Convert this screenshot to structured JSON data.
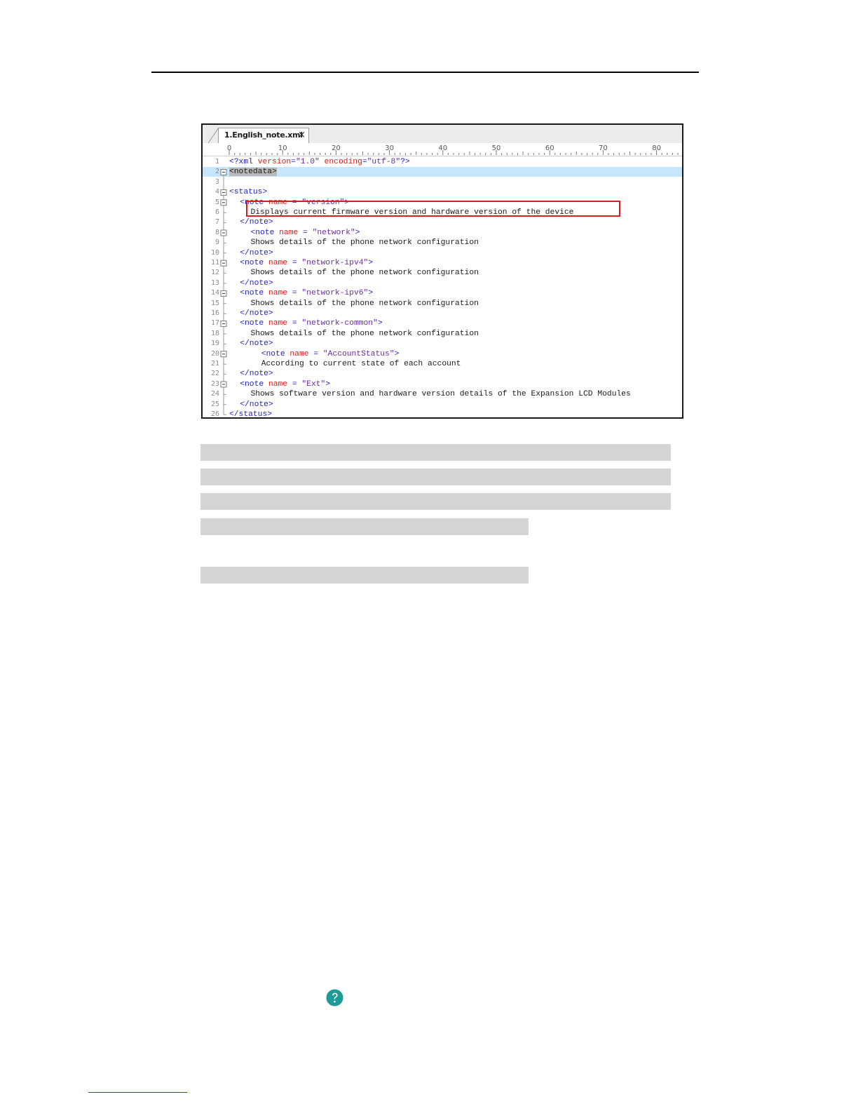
{
  "editor": {
    "tab_title": "1.English_note.xml",
    "tab_close": "×",
    "ruler_labels": [
      "0",
      "10",
      "20",
      "30",
      "40",
      "50",
      "60",
      "70",
      "80"
    ],
    "colors": {
      "tag": "#1f22c4",
      "attr": "#e01a1a",
      "value": "#6a2b9e",
      "current_line": "#c6e6fb",
      "highlight_box": "#d81e1e"
    },
    "lines": [
      {
        "n": "1",
        "indent": 0,
        "parts": [
          [
            "pi",
            "<?xml "
          ],
          [
            "attr",
            "version"
          ],
          [
            "pi",
            "="
          ],
          [
            "val",
            "\"1.0\""
          ],
          [
            "pi",
            " "
          ],
          [
            "attr",
            "encoding"
          ],
          [
            "pi",
            "="
          ],
          [
            "val",
            "\"utf-8\""
          ],
          [
            "pi",
            "?>"
          ]
        ]
      },
      {
        "n": "2",
        "indent": 0,
        "parts": [
          [
            "sel",
            "<notedata>"
          ]
        ]
      },
      {
        "n": "3",
        "indent": 0,
        "parts": []
      },
      {
        "n": "4",
        "indent": 0,
        "parts": [
          [
            "tag",
            "<status>"
          ]
        ]
      },
      {
        "n": "5",
        "indent": 2,
        "parts": [
          [
            "tag",
            "<note "
          ],
          [
            "attr",
            "name"
          ],
          [
            "tag",
            " = "
          ],
          [
            "val",
            "\"version\""
          ],
          [
            "tag",
            ">"
          ]
        ]
      },
      {
        "n": "6",
        "indent": 4,
        "parts": [
          [
            "txt",
            "Displays current firmware version and hardware version of the device"
          ]
        ]
      },
      {
        "n": "7",
        "indent": 2,
        "parts": [
          [
            "tag",
            "</note>"
          ]
        ]
      },
      {
        "n": "8",
        "indent": 4,
        "parts": [
          [
            "tag",
            "<note "
          ],
          [
            "attr",
            "name"
          ],
          [
            "tag",
            " = "
          ],
          [
            "val",
            "\"network\""
          ],
          [
            "tag",
            ">"
          ]
        ]
      },
      {
        "n": "9",
        "indent": 4,
        "parts": [
          [
            "txt",
            "Shows details of the phone network configuration"
          ]
        ]
      },
      {
        "n": "10",
        "indent": 2,
        "parts": [
          [
            "tag",
            "</note>"
          ]
        ]
      },
      {
        "n": "11",
        "indent": 2,
        "parts": [
          [
            "tag",
            "<note "
          ],
          [
            "attr",
            "name"
          ],
          [
            "tag",
            " = "
          ],
          [
            "val",
            "\"network-ipv4\""
          ],
          [
            "tag",
            ">"
          ]
        ]
      },
      {
        "n": "12",
        "indent": 4,
        "parts": [
          [
            "txt",
            "Shows details of the phone network configuration"
          ]
        ]
      },
      {
        "n": "13",
        "indent": 2,
        "parts": [
          [
            "tag",
            "</note>"
          ]
        ]
      },
      {
        "n": "14",
        "indent": 2,
        "parts": [
          [
            "tag",
            "<note "
          ],
          [
            "attr",
            "name"
          ],
          [
            "tag",
            " = "
          ],
          [
            "val",
            "\"network-ipv6\""
          ],
          [
            "tag",
            ">"
          ]
        ]
      },
      {
        "n": "15",
        "indent": 4,
        "parts": [
          [
            "txt",
            "Shows details of the phone network configuration"
          ]
        ]
      },
      {
        "n": "16",
        "indent": 2,
        "parts": [
          [
            "tag",
            "</note>"
          ]
        ]
      },
      {
        "n": "17",
        "indent": 2,
        "parts": [
          [
            "tag",
            "<note "
          ],
          [
            "attr",
            "name"
          ],
          [
            "tag",
            " = "
          ],
          [
            "val",
            "\"network-common\""
          ],
          [
            "tag",
            ">"
          ]
        ]
      },
      {
        "n": "18",
        "indent": 4,
        "parts": [
          [
            "txt",
            "Shows details of the phone network configuration"
          ]
        ]
      },
      {
        "n": "19",
        "indent": 2,
        "parts": [
          [
            "tag",
            "</note>"
          ]
        ]
      },
      {
        "n": "20",
        "indent": 6,
        "parts": [
          [
            "tag",
            "<note "
          ],
          [
            "attr",
            "name"
          ],
          [
            "tag",
            " = "
          ],
          [
            "val",
            "\"AccountStatus\""
          ],
          [
            "tag",
            ">"
          ]
        ]
      },
      {
        "n": "21",
        "indent": 6,
        "parts": [
          [
            "txt",
            "According to current state of each account"
          ]
        ]
      },
      {
        "n": "22",
        "indent": 2,
        "parts": [
          [
            "tag",
            "</note>"
          ]
        ]
      },
      {
        "n": "23",
        "indent": 2,
        "parts": [
          [
            "tag",
            "<note "
          ],
          [
            "attr",
            "name"
          ],
          [
            "tag",
            " = "
          ],
          [
            "val",
            "\"Ext\""
          ],
          [
            "tag",
            ">"
          ]
        ]
      },
      {
        "n": "24",
        "indent": 4,
        "parts": [
          [
            "txt",
            "Shows software version and hardware version details of the Expansion LCD Modules"
          ]
        ]
      },
      {
        "n": "25",
        "indent": 2,
        "parts": [
          [
            "tag",
            "</note>"
          ]
        ]
      },
      {
        "n": "26",
        "indent": 0,
        "parts": [
          [
            "tag",
            "</status>"
          ]
        ]
      }
    ],
    "fold_lines": [
      "2",
      "4",
      "5",
      "8",
      "11",
      "14",
      "17",
      "20",
      "23"
    ],
    "highlighted_line": "2",
    "boxed_line": "6"
  },
  "page": {
    "help_icon": "question-circle-icon",
    "help_color": "#1e9b96"
  }
}
